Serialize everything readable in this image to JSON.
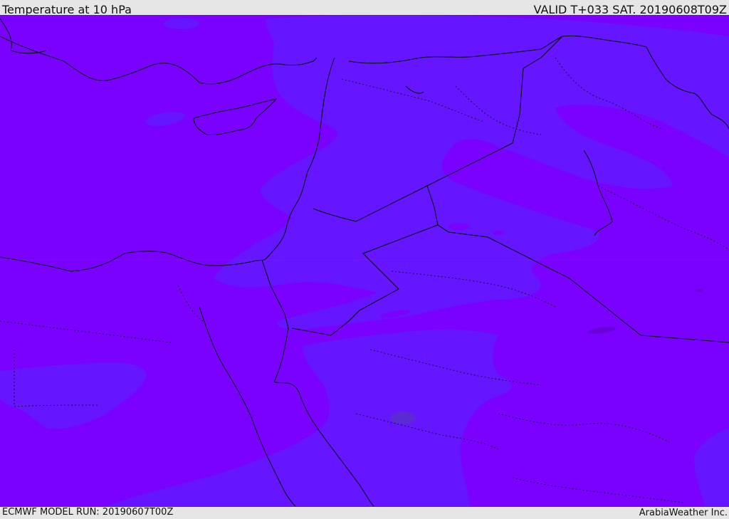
{
  "header": {
    "title": "Temperature at 10 hPa",
    "valid": "VALID T+033 SAT. 20190608T09Z"
  },
  "footer": {
    "model_run": "ECMWF MODEL RUN: 20190607T00Z",
    "credit": "ArabiaWeather Inc."
  },
  "map": {
    "field": "temperature",
    "level": "10 hPa",
    "colors": {
      "warm_shade": "#7a00ff",
      "cool_shade": "#6515ff",
      "coolest_spot": "#5a2ad4",
      "land_border": "#000000"
    }
  }
}
